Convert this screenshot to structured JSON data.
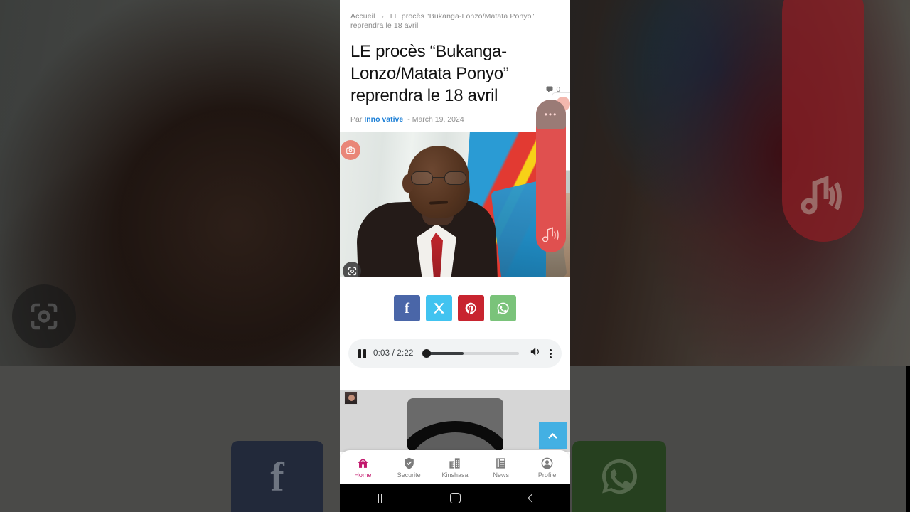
{
  "breadcrumb": {
    "home": "Accueil",
    "separator": "›",
    "current": "LE procès \"Bukanga-Lonzo/Matata Ponyo\" reprendra le 18 avril"
  },
  "article": {
    "title": "LE procès “Bukanga-Lonzo/Matata Ponyo” reprendra le 18 avril",
    "by_label": "Par",
    "author": "Inno vative",
    "dash": "-",
    "date": "March 19, 2024",
    "comment_count": "0"
  },
  "share": {
    "facebook": "f",
    "twitter": "X",
    "pinterest": "P",
    "whatsapp": "WhatsApp",
    "colors": {
      "facebook": "#4a66a8",
      "twitter": "#41c3f0",
      "pinterest": "#c8242f",
      "whatsapp": "#7ac37a"
    }
  },
  "player": {
    "state": "playing",
    "elapsed": "0:03",
    "duration": "2:22",
    "time_display": "0:03 / 2:22",
    "progress_percent": 42,
    "volume_state": "on"
  },
  "floating": {
    "audio_pill_color": "#e0504f",
    "scroll_top_label": "Scroll to top",
    "scroll_top_color": "#43b0e3"
  },
  "tabbar": {
    "active": "Home",
    "items": [
      {
        "label": "Home",
        "icon": "home-icon"
      },
      {
        "label": "Securite",
        "icon": "shield-check-icon"
      },
      {
        "label": "Kinshasa",
        "icon": "buildings-icon"
      },
      {
        "label": "News",
        "icon": "newspaper-icon"
      },
      {
        "label": "Profile",
        "icon": "person-circle-icon"
      }
    ],
    "active_color": "#c2186d",
    "inactive_color": "#7c7c7c"
  },
  "system_nav": {
    "recents": "Recent apps",
    "home": "Home",
    "back": "Back"
  },
  "lens": {
    "top_badge": "camera-icon",
    "bottom_badge": "google-lens-icon",
    "backdrop_badge": "google-lens-icon"
  }
}
